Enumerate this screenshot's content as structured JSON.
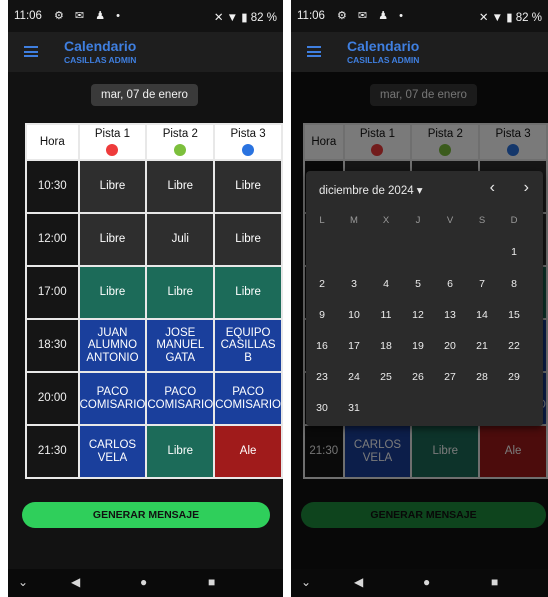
{
  "status": {
    "time": "11:06",
    "battery": "82 %",
    "left_icons": "⚙ ✉ ♟ •",
    "right_icons": "✕ ▼ ▮"
  },
  "app": {
    "title": "Calendario",
    "subtitle": "CASILLAS ADMIN"
  },
  "date_button": "mar, 07 de enero",
  "table": {
    "hour_header": "Hora",
    "courts": [
      {
        "label": "Pista 1",
        "color": "#ee3b3b"
      },
      {
        "label": "Pista 2",
        "color": "#7cbf3c"
      },
      {
        "label": "Pista 3",
        "color": "#2a73e0"
      }
    ],
    "rows": [
      {
        "hour": "10:30",
        "cells": [
          {
            "text": "Libre",
            "state": "gris"
          },
          {
            "text": "Libre",
            "state": "gris"
          },
          {
            "text": "Libre",
            "state": "gris"
          }
        ]
      },
      {
        "hour": "12:00",
        "cells": [
          {
            "text": "Libre",
            "state": "gris"
          },
          {
            "text": "Juli",
            "state": "gris"
          },
          {
            "text": "Libre",
            "state": "gris"
          }
        ]
      },
      {
        "hour": "17:00",
        "cells": [
          {
            "text": "Libre",
            "state": "verde"
          },
          {
            "text": "Libre",
            "state": "verde"
          },
          {
            "text": "Libre",
            "state": "verde"
          }
        ]
      },
      {
        "hour": "18:30",
        "cells": [
          {
            "text": "JUAN\nALUMNO\nANTONIO",
            "state": "azul"
          },
          {
            "text": "JOSE\nMANUEL\nGATA",
            "state": "azul"
          },
          {
            "text": "EQUIPO\nCASILLAS\nB",
            "state": "azul"
          }
        ]
      },
      {
        "hour": "20:00",
        "cells": [
          {
            "text": "PACO\nCOMISARIO",
            "state": "azul"
          },
          {
            "text": "PACO\nCOMISARIO",
            "state": "azul"
          },
          {
            "text": "PACO\nCOMISARIO",
            "state": "azul"
          }
        ]
      },
      {
        "hour": "21:30",
        "cells": [
          {
            "text": "CARLOS\nVELA",
            "state": "azul"
          },
          {
            "text": "Libre",
            "state": "verde"
          },
          {
            "text": "Ale",
            "state": "rojo"
          }
        ]
      }
    ]
  },
  "generate_button": "GENERAR MENSAJE",
  "navbar": {
    "collapse": "⌄",
    "back": "◀",
    "home": "●",
    "recents": "■"
  },
  "date_picker": {
    "month_label": "diciembre de 2024 ▾",
    "prev": "‹",
    "next": "›",
    "weekdays": [
      "L",
      "M",
      "X",
      "J",
      "V",
      "S",
      "D"
    ],
    "days": [
      "1",
      "2",
      "3",
      "4",
      "5",
      "6",
      "7",
      "8",
      "9",
      "10",
      "11",
      "12",
      "13",
      "14",
      "15",
      "16",
      "17",
      "18",
      "19",
      "20",
      "21",
      "22",
      "23",
      "24",
      "25",
      "26",
      "27",
      "28",
      "29",
      "30",
      "31"
    ]
  }
}
